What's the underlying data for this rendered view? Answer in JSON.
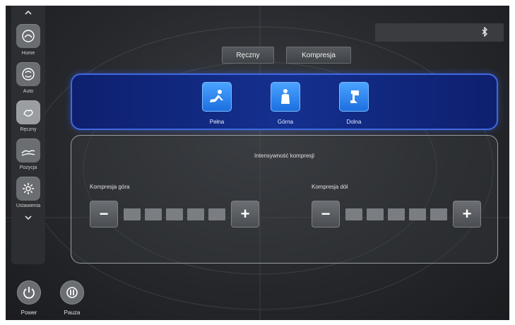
{
  "sidebar": {
    "items": [
      {
        "label": "Home",
        "icon": "home-massage-icon"
      },
      {
        "label": "Auto",
        "icon": "auto-cycle-icon"
      },
      {
        "label": "Ręczny",
        "icon": "hand-manual-icon",
        "active": true
      },
      {
        "label": "Pozycja",
        "icon": "recline-position-icon"
      },
      {
        "label": "Ustawienia",
        "icon": "gear-icon"
      }
    ]
  },
  "status": {
    "icon": "bluetooth-icon"
  },
  "tabs": [
    {
      "label": "Ręczny"
    },
    {
      "label": "Kompresja"
    }
  ],
  "modes": [
    {
      "label": "Pełna",
      "icon": "full-body-icon"
    },
    {
      "label": "Górna",
      "icon": "upper-body-icon"
    },
    {
      "label": "Dolna",
      "icon": "lower-body-icon"
    }
  ],
  "intensity": {
    "title": "Intensywność kompresji",
    "upper": {
      "label": "Kompresja góra",
      "level": 0,
      "max": 5
    },
    "lower": {
      "label": "Kompresja dół",
      "level": 0,
      "max": 5
    },
    "minus": "−",
    "plus": "+"
  },
  "bottom": {
    "power": "Power",
    "pause": "Pauza"
  },
  "colors": {
    "accent": "#3f6ae0",
    "mode_button": "#2a88f0",
    "background": "#26282c"
  }
}
